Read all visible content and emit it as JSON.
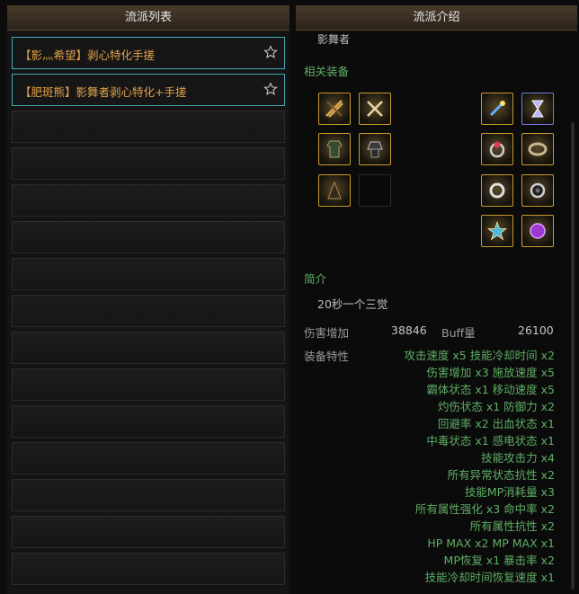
{
  "left": {
    "title": "流派列表",
    "items": [
      {
        "name": "【影灬希望】剥心特化手搓"
      },
      {
        "name": "【肥斑熊】影舞者剥心特化+手搓"
      }
    ],
    "empty_slots": 13
  },
  "right": {
    "title": "流派介绍",
    "class_name": "影舞者",
    "equip_label": "相关装备",
    "intro_label": "简介",
    "intro_text": "20秒一个三觉",
    "damage_label": "伤害增加",
    "damage_value": "38846",
    "buff_label": "Buff量",
    "buff_value": "26100",
    "traits_label": "装备特性",
    "traits": [
      "攻击速度 x5   技能冷却时间 x2",
      "伤害增加 x3   施放速度 x5",
      "霸体状态 x1   移动速度 x5",
      "灼伤状态 x1   防御力 x2",
      "回避率 x2   出血状态 x1",
      "中毒状态 x1   感电状态 x1",
      "技能攻击力 x4",
      "所有异常状态抗性 x2",
      "技能MP消耗量 x3",
      "所有属性强化 x3   命中率 x2",
      "所有属性抗性 x2",
      "HP MAX x2   MP MAX x1",
      "MP恢复 x1   暴击率 x2",
      "技能冷却时间恢复速度 x1"
    ]
  },
  "colors": {
    "accent_gold": "#e2a14b",
    "accent_green": "#5fae64",
    "selected_border": "#49a7b6",
    "equip_border": "#c89a2a"
  },
  "equip_icons": [
    "weapon-bundle-icon",
    "crossed-blades-icon",
    "dagger-spark-icon",
    "hourglass-icon",
    "armor-coat-icon",
    "armor-hat-icon",
    "ring-red-icon",
    "bracelet-icon",
    "cloak-icon",
    "empty-slot",
    "ring-silver-icon",
    "ring-dark-icon",
    "star-gem-icon",
    "purple-orb-icon"
  ]
}
